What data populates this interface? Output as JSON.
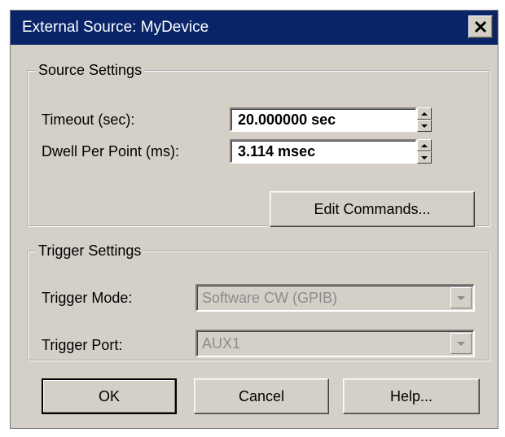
{
  "window": {
    "title": "External Source: MyDevice",
    "close_icon": "close-icon",
    "colors": {
      "titlebar": "#0a246a",
      "face": "#d4d0c8",
      "disabled_text": "#8c8c8c"
    }
  },
  "source_settings": {
    "legend": "Source Settings",
    "timeout": {
      "label": "Timeout (sec):",
      "value": "20.000000 sec"
    },
    "dwell": {
      "label": "Dwell Per Point (ms):",
      "value": "3.114 msec"
    },
    "edit_commands_label": "Edit Commands..."
  },
  "trigger_settings": {
    "legend": "Trigger Settings",
    "mode": {
      "label": "Trigger Mode:",
      "value": "Software CW (GPIB)",
      "enabled": false
    },
    "port": {
      "label": "Trigger Port:",
      "value": "AUX1",
      "enabled": false
    }
  },
  "buttons": {
    "ok": "OK",
    "cancel": "Cancel",
    "help": "Help..."
  }
}
